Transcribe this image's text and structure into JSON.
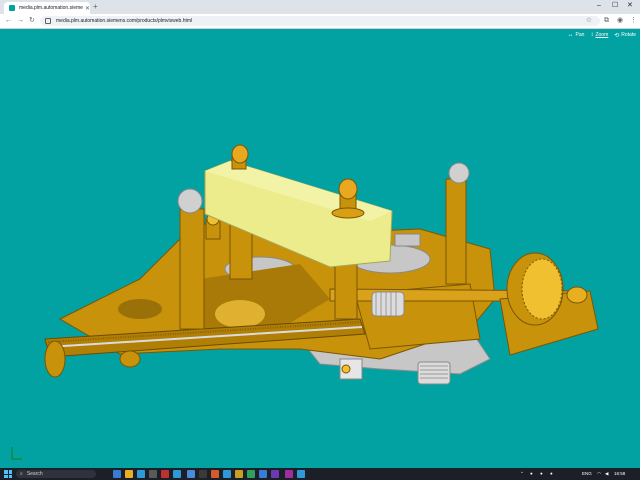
{
  "browser": {
    "tab_title": "media.plm.automation.siemens...",
    "new_tab": "+",
    "url": "media.plm.automation.siemens.com/products/plmvisweb.html",
    "window_controls": {
      "minimize": "–",
      "maximize": "☐",
      "close": "✕"
    }
  },
  "viewer": {
    "background": "#03a2a2",
    "tools": [
      {
        "label": "Pan",
        "icon": "pan-icon"
      },
      {
        "label": "Zoom",
        "icon": "zoom-icon"
      },
      {
        "label": "Rotate",
        "icon": "rotate-icon"
      }
    ],
    "active_tool": "Zoom",
    "model_colors": {
      "body": "#c8920a",
      "highlight": "#f1c232",
      "block": "#ecec8c",
      "metal": "#c7c7c7"
    }
  },
  "taskbar": {
    "search_label": "Search",
    "tray_text": "ENG",
    "clock": "16:58"
  }
}
